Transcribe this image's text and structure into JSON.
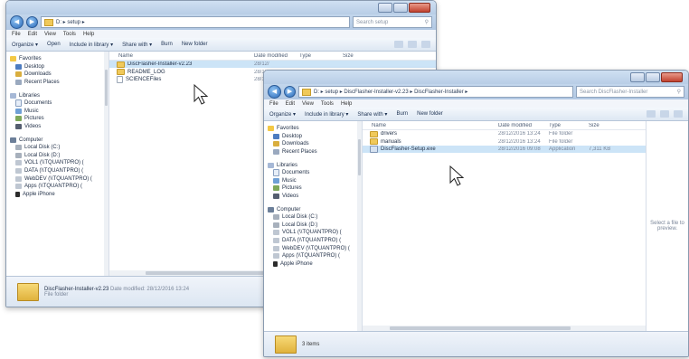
{
  "menu": [
    "File",
    "Edit",
    "View",
    "Tools",
    "Help"
  ],
  "window1": {
    "address": "D: ▸ setup ▸",
    "search_placeholder": "Search setup",
    "toolbar": [
      "Organize ▾",
      "Open",
      "Include in library ▾",
      "Share with ▾",
      "Burn",
      "New folder"
    ],
    "columns": [
      "Name",
      "Date modified",
      "Type",
      "Size"
    ],
    "nav": [
      {
        "label": "Favorites",
        "icon": "star-icon",
        "level": 0
      },
      {
        "label": "Desktop",
        "icon": "desktop-icon",
        "level": 1
      },
      {
        "label": "Downloads",
        "icon": "downloads-icon",
        "level": 1
      },
      {
        "label": "Recent Places",
        "icon": "recent-places-icon",
        "level": 1
      },
      {
        "label": "Libraries",
        "icon": "library-icon",
        "level": 0,
        "gap": true
      },
      {
        "label": "Documents",
        "icon": "document-icon",
        "level": 1
      },
      {
        "label": "Music",
        "icon": "music-icon",
        "level": 1
      },
      {
        "label": "Pictures",
        "icon": "pictures-icon",
        "level": 1
      },
      {
        "label": "Videos",
        "icon": "videos-icon",
        "level": 1
      },
      {
        "label": "Computer",
        "icon": "computer-icon",
        "level": 0,
        "gap": true
      },
      {
        "label": "Local Disk (C:)",
        "icon": "disk-icon",
        "level": 1
      },
      {
        "label": "Local Disk (D:)",
        "icon": "disk-icon",
        "level": 1
      },
      {
        "label": "VOL1 (\\\\TQUANTPRO) (",
        "icon": "network-drive-icon",
        "level": 1
      },
      {
        "label": "DATA (\\\\TQUANTPRO) (",
        "icon": "network-drive-icon",
        "level": 1
      },
      {
        "label": "WebDEV (\\\\TQUANTPRO) (",
        "icon": "network-drive-icon",
        "level": 1
      },
      {
        "label": "Apps (\\\\TQUANTPRO) (",
        "icon": "network-drive-icon",
        "level": 1
      },
      {
        "label": "Apple iPhone",
        "icon": "phone-icon",
        "level": 1
      }
    ],
    "files": [
      {
        "name": "DiscFlasher-Installer-v2.23",
        "date": "28/12/",
        "icon": "folder-icon",
        "selected": true
      },
      {
        "name": "README_LOG",
        "date": "28/12/",
        "icon": "folder-icon",
        "selected": false
      },
      {
        "name": "SCIENCEFiles",
        "date": "28/12/",
        "icon": "file-icon",
        "selected": false
      }
    ],
    "details": {
      "title": "DiscFlasher-Installer-v2.23",
      "modified": "Date modified: 28/12/2016 13:24",
      "type": "File folder"
    }
  },
  "window2": {
    "address": "D: ▸ setup ▸ DiscFlasher-Installer-v2.23 ▸ DiscFlasher-Installer ▸",
    "search_placeholder": "Search DiscFlasher-Installer",
    "toolbar": [
      "Organize ▾",
      "Include in library ▾",
      "Share with ▾",
      "Burn",
      "New folder"
    ],
    "columns": [
      "Name",
      "Date modified",
      "Type",
      "Size"
    ],
    "nav": [
      {
        "label": "Favorites",
        "icon": "star-icon",
        "level": 0
      },
      {
        "label": "Desktop",
        "icon": "desktop-icon",
        "level": 1
      },
      {
        "label": "Downloads",
        "icon": "downloads-icon",
        "level": 1
      },
      {
        "label": "Recent Places",
        "icon": "recent-places-icon",
        "level": 1
      },
      {
        "label": "Libraries",
        "icon": "library-icon",
        "level": 0,
        "gap": true
      },
      {
        "label": "Documents",
        "icon": "document-icon",
        "level": 1
      },
      {
        "label": "Music",
        "icon": "music-icon",
        "level": 1
      },
      {
        "label": "Pictures",
        "icon": "pictures-icon",
        "level": 1
      },
      {
        "label": "Videos",
        "icon": "videos-icon",
        "level": 1
      },
      {
        "label": "Computer",
        "icon": "computer-icon",
        "level": 0,
        "gap": true
      },
      {
        "label": "Local Disk (C:)",
        "icon": "disk-icon",
        "level": 1
      },
      {
        "label": "Local Disk (D:)",
        "icon": "disk-icon",
        "level": 1
      },
      {
        "label": "VOL1 (\\\\TQUANTPRO) (",
        "icon": "network-drive-icon",
        "level": 1
      },
      {
        "label": "DATA (\\\\TQUANTPRO) (",
        "icon": "network-drive-icon",
        "level": 1
      },
      {
        "label": "WebDEV (\\\\TQUANTPRO) (",
        "icon": "network-drive-icon",
        "level": 1
      },
      {
        "label": "Apps (\\\\TQUANTPRO) (",
        "icon": "network-drive-icon",
        "level": 1
      },
      {
        "label": "Apple iPhone",
        "icon": "phone-icon",
        "level": 1
      }
    ],
    "files": [
      {
        "name": "drivers",
        "date": "28/12/2016 13:24",
        "type": "File folder",
        "size": "",
        "icon": "folder-icon",
        "selected": false
      },
      {
        "name": "manuals",
        "date": "28/12/2016 13:24",
        "type": "File folder",
        "size": "",
        "icon": "folder-icon",
        "selected": false
      },
      {
        "name": "DiscFlasher-Setup.exe",
        "date": "28/12/2016 09:08",
        "type": "Application",
        "size": "7,311 KB",
        "icon": "application-icon",
        "selected": true
      }
    ],
    "preview_text": "Select a file to preview.",
    "status": "3 items"
  }
}
